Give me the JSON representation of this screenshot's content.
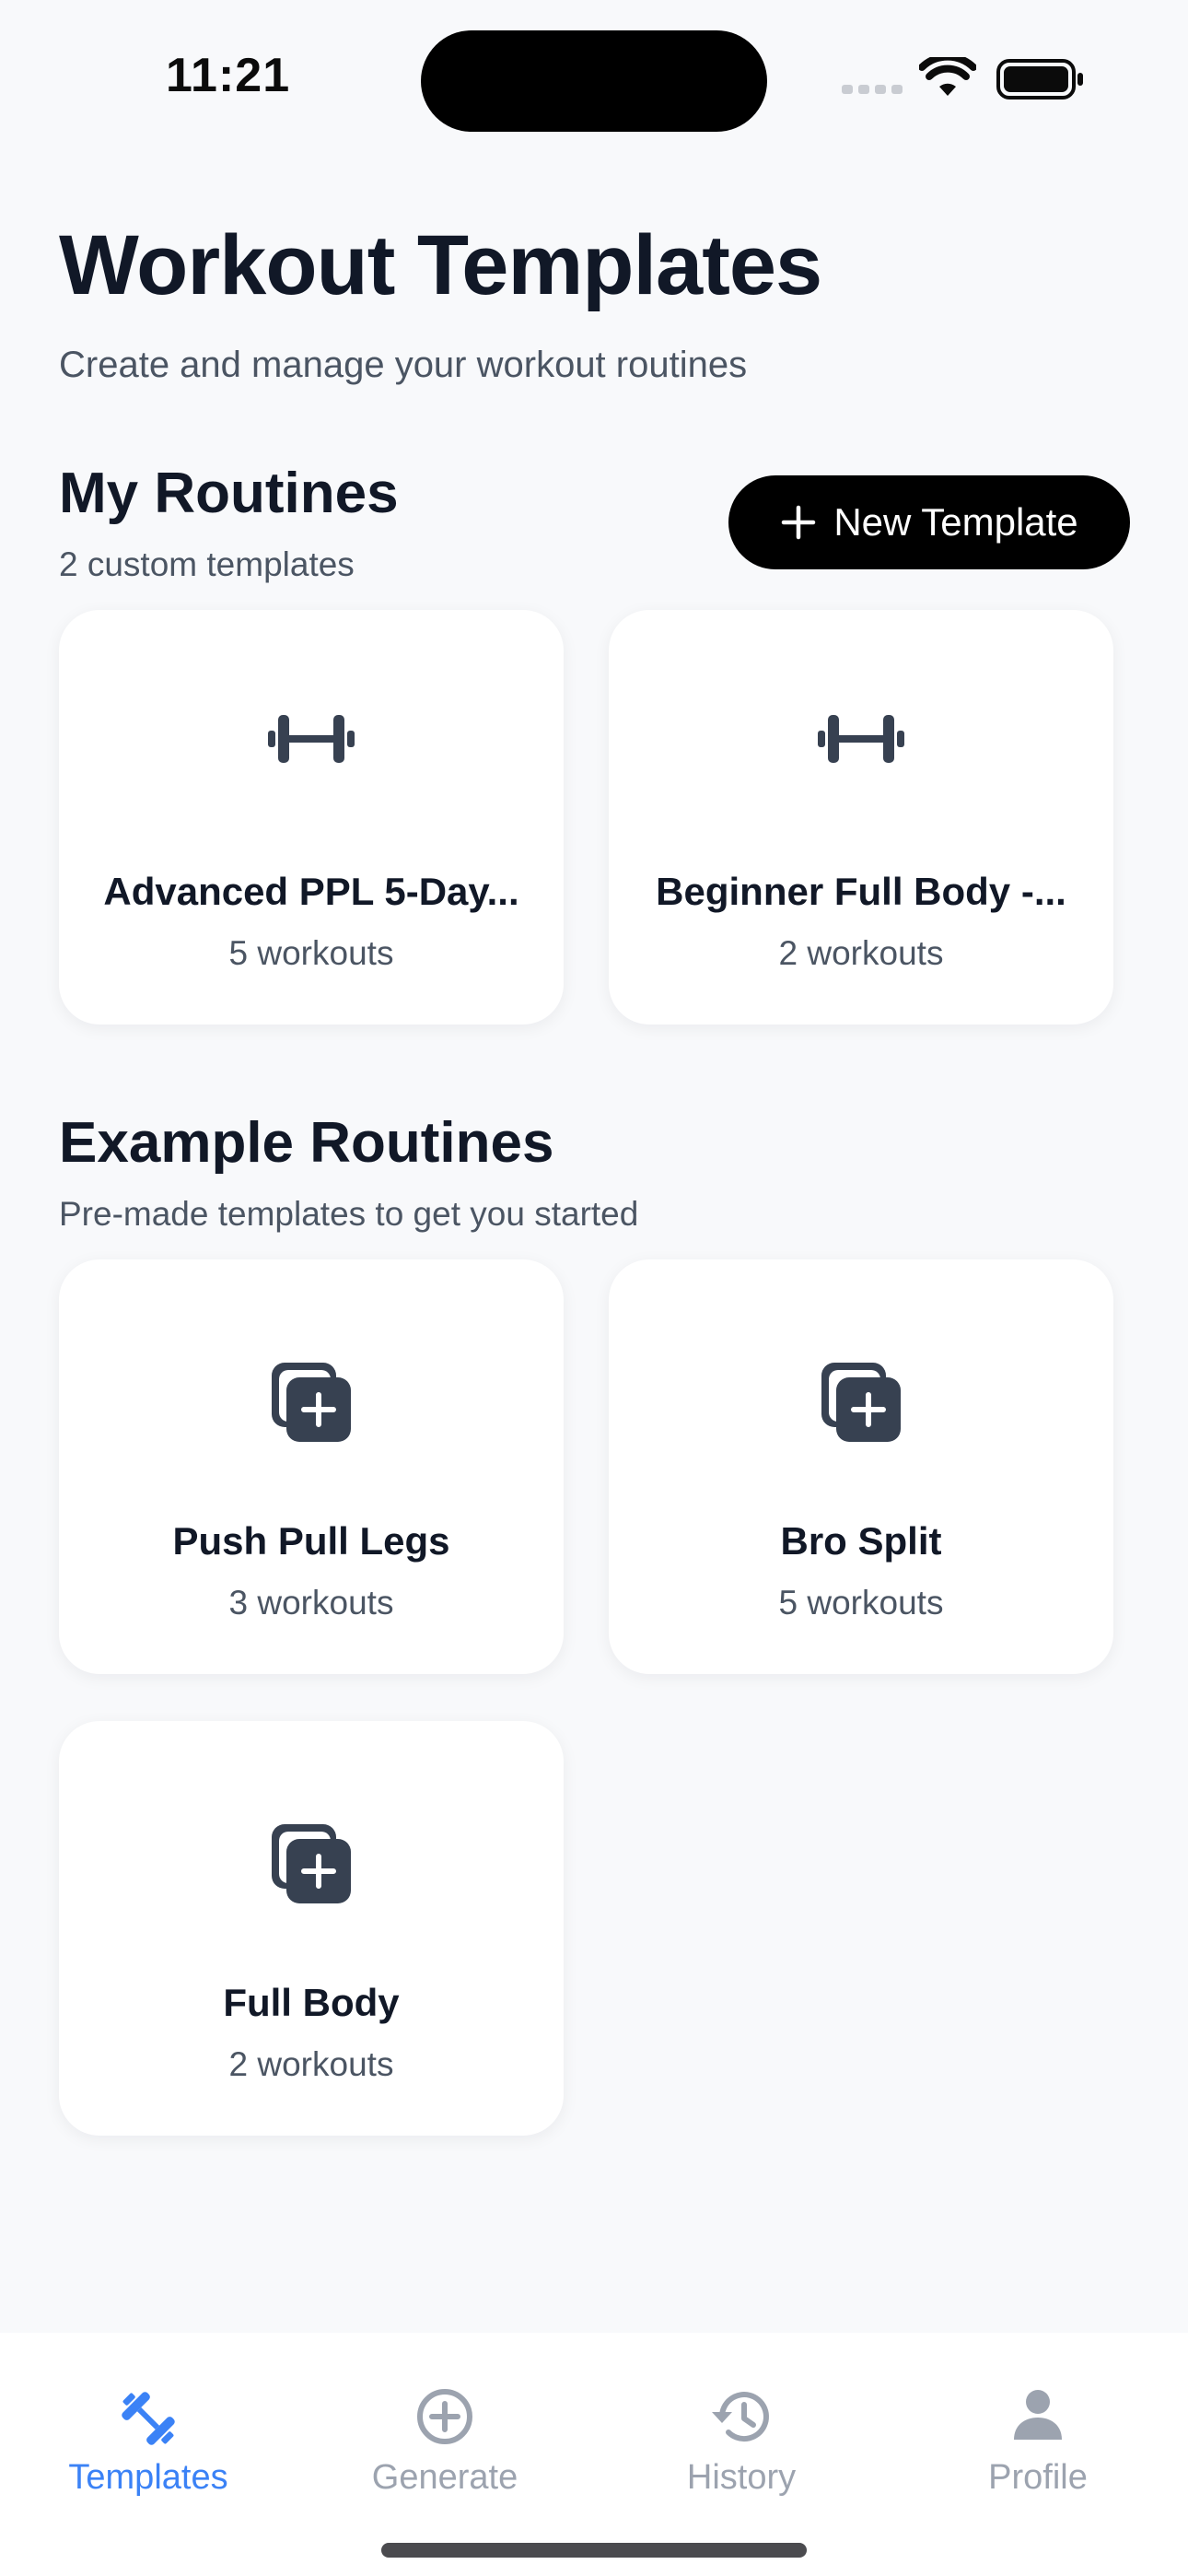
{
  "status": {
    "time": "11:21"
  },
  "header": {
    "title": "Workout Templates",
    "subtitle": "Create and manage your workout routines"
  },
  "my_routines": {
    "title": "My Routines",
    "subtitle": "2 custom templates",
    "new_button_label": "New Template",
    "cards": [
      {
        "name": "Advanced PPL 5-Day...",
        "count": "5 workouts",
        "icon": "dumbbell-icon"
      },
      {
        "name": "Beginner Full Body -...",
        "count": "2 workouts",
        "icon": "dumbbell-icon"
      }
    ]
  },
  "example_routines": {
    "title": "Example Routines",
    "subtitle": "Pre-made templates to get you started",
    "cards": [
      {
        "name": "Push Pull Legs",
        "count": "3 workouts",
        "icon": "copy-plus-icon"
      },
      {
        "name": "Bro Split",
        "count": "5 workouts",
        "icon": "copy-plus-icon"
      },
      {
        "name": "Full Body",
        "count": "2 workouts",
        "icon": "copy-plus-icon"
      }
    ]
  },
  "tabbar": {
    "active_color": "#3b82f6",
    "inactive_color": "#9ca3af",
    "tabs": [
      {
        "label": "Templates",
        "icon": "dumbbell-icon",
        "active": true
      },
      {
        "label": "Generate",
        "icon": "plus-circle-icon",
        "active": false
      },
      {
        "label": "History",
        "icon": "history-icon",
        "active": false
      },
      {
        "label": "Profile",
        "icon": "person-icon",
        "active": false
      }
    ]
  }
}
